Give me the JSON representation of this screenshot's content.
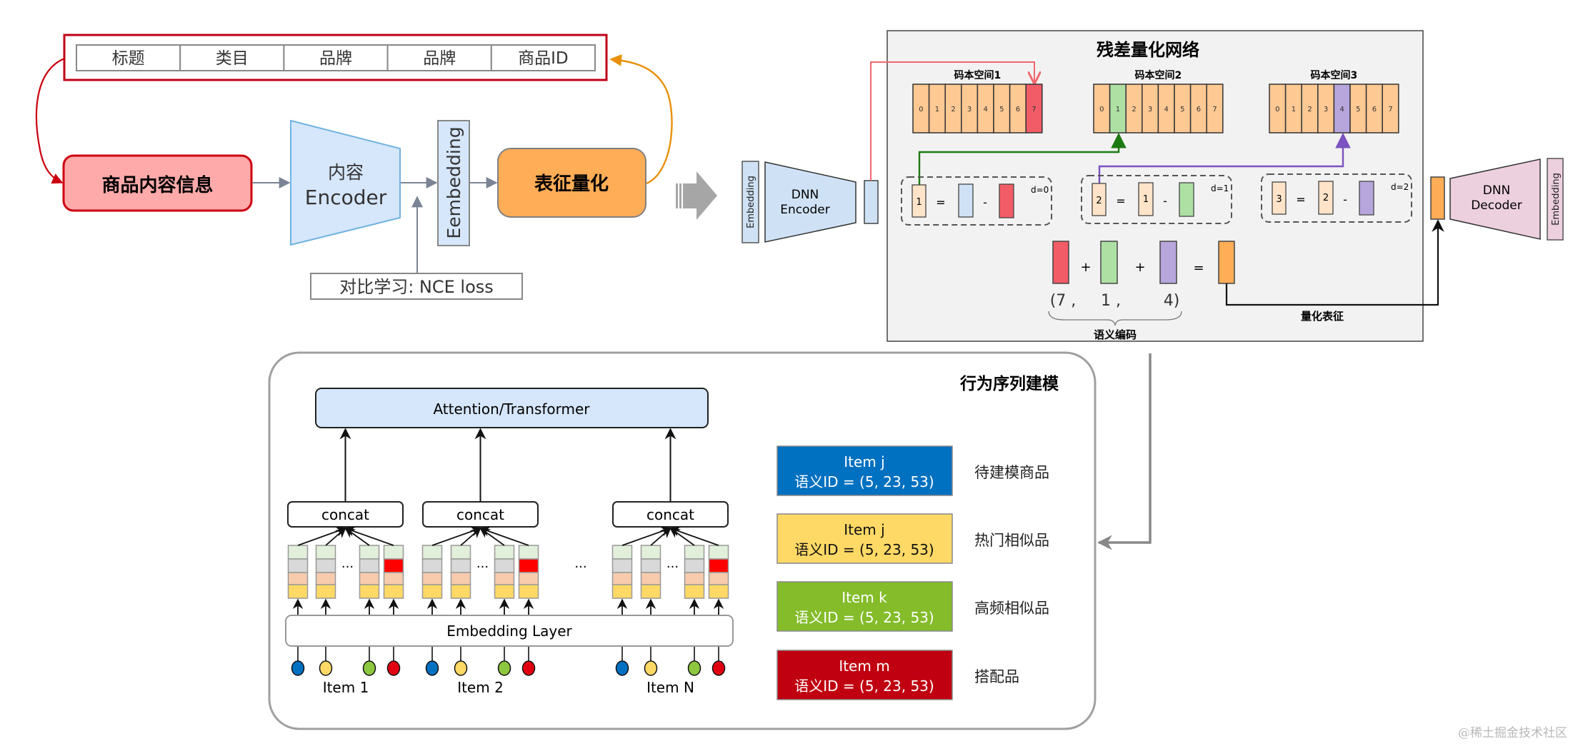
{
  "feature_table": {
    "cells": [
      "标题",
      "类目",
      "品牌",
      "品牌",
      "商品ID"
    ]
  },
  "content_pipeline": {
    "item_info_label": "商品内容信息",
    "encoder_label_line1": "内容",
    "encoder_label_line2": "Encoder",
    "embedding_label": "Eembedding",
    "quantize_label": "表征量化",
    "contrastive_label": "对比学习: NCE loss"
  },
  "rq_network": {
    "title": "残差量化网络",
    "left_embedding_label": "Embedding",
    "encoder_line1": "DNN",
    "encoder_line2": "Encoder",
    "decoder_line1": "DNN",
    "decoder_line2": "Decoder",
    "right_embedding_label": "Embedding",
    "codebooks": [
      {
        "label": "码本空间1",
        "codes": [
          "0",
          "1",
          "2",
          "3",
          "4",
          "5",
          "6",
          "7"
        ],
        "selected": 7,
        "color": "#f25c66"
      },
      {
        "label": "码本空间2",
        "codes": [
          "0",
          "1",
          "2",
          "3",
          "4",
          "5",
          "6",
          "7"
        ],
        "selected": 1,
        "color": "#aee0a4"
      },
      {
        "label": "码本空间3",
        "codes": [
          "0",
          "1",
          "2",
          "3",
          "4",
          "5",
          "6",
          "7"
        ],
        "selected": 4,
        "color": "#b7a6dc"
      }
    ],
    "residual_steps": [
      {
        "result": "1",
        "minuend": "",
        "depth": "d=0"
      },
      {
        "result": "2",
        "minuend": "1",
        "depth": "d=1"
      },
      {
        "result": "3",
        "minuend": "2",
        "depth": "d=2"
      }
    ],
    "equals_sign": "=",
    "minus_sign": "-",
    "plus_sign": "+",
    "semantic_code_tuple": [
      "(7 ,",
      "1 ,",
      "4)"
    ],
    "semantic_code_label": "语义编码",
    "quantized_label": "量化表征"
  },
  "sequence_modeling": {
    "title": "行为序列建模",
    "attention_label": "Attention/Transformer",
    "concat_label": "concat",
    "embedding_layer_label": "Embedding Layer",
    "ellipsis": "···",
    "items": [
      "Item 1",
      "Item 2",
      "Item N"
    ],
    "legend": [
      {
        "name": "Item j",
        "id_text": "语义ID = (5, 23, 53)",
        "desc": "待建模商品",
        "bg": "#0070c0",
        "fg": "#ffffff"
      },
      {
        "name": "Item j",
        "id_text": "语义ID = (5, 23, 53)",
        "desc": "热门相似品",
        "bg": "#ffd966",
        "fg": "#111111"
      },
      {
        "name": "Item k",
        "id_text": "语义ID = (5, 23, 53)",
        "desc": "高频相似品",
        "bg": "#84bc2a",
        "fg": "#ffffff"
      },
      {
        "name": "Item m",
        "id_text": "语义ID = (5, 23, 53)",
        "desc": "搭配品",
        "bg": "#c00010",
        "fg": "#ffffff"
      }
    ],
    "dot_colors": [
      "#0070c0",
      "#ffd966",
      "#8dc63f",
      "#e00010"
    ]
  },
  "colors": {
    "table_border": "#c00018",
    "item_info_fill": "#ffaaaa",
    "item_info_stroke": "#cc0010",
    "encoder_fill": "#d6e6fb",
    "encoder_stroke": "#6fb3e0",
    "quantize_fill": "#ffad56",
    "orange_arrow": "#e8900a",
    "gray_arrow": "#7a8494",
    "codebook_fill": "#ffc994",
    "residual_fill": "#ffe4c9",
    "latent_fill": "#cfe2f5",
    "decoder_fill": "#ecd0de",
    "rq_panel_fill": "#f2f2f2",
    "red_line": "#f0666e",
    "green_line": "#1d7a12",
    "purple_line": "#7b52c0"
  },
  "watermark": "@稀土掘金技术社区"
}
